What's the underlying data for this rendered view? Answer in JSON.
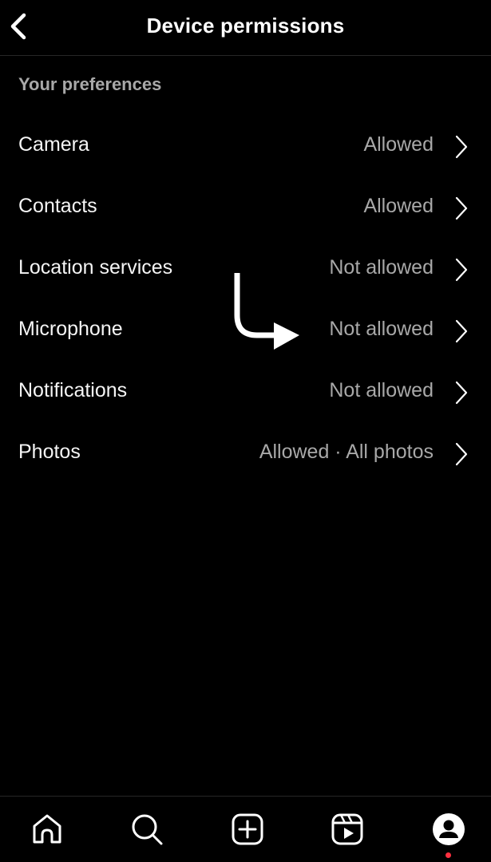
{
  "header": {
    "title": "Device permissions",
    "back_icon": "chevron-left-icon"
  },
  "section": {
    "label": "Your preferences"
  },
  "permissions": [
    {
      "label": "Camera",
      "value": "Allowed"
    },
    {
      "label": "Contacts",
      "value": "Allowed"
    },
    {
      "label": "Location services",
      "value": "Not allowed"
    },
    {
      "label": "Microphone",
      "value": "Not allowed"
    },
    {
      "label": "Notifications",
      "value": "Not allowed"
    },
    {
      "label": "Photos",
      "value": "Allowed · All photos"
    }
  ],
  "annotation": {
    "type": "arrow",
    "points_to": "Microphone",
    "color": "#ffffff"
  },
  "tabbar": {
    "tabs": [
      {
        "name": "home",
        "icon": "home-icon"
      },
      {
        "name": "search",
        "icon": "search-icon"
      },
      {
        "name": "create",
        "icon": "plus-square-icon"
      },
      {
        "name": "reels",
        "icon": "reels-icon"
      },
      {
        "name": "profile",
        "icon": "profile-icon",
        "active": true,
        "has_notification_dot": true
      }
    ],
    "notification_color": "#ff3040"
  },
  "colors": {
    "background": "#000000",
    "primary_text": "#f5f5f5",
    "secondary_text": "#a8a8a8",
    "divider": "#262626"
  }
}
